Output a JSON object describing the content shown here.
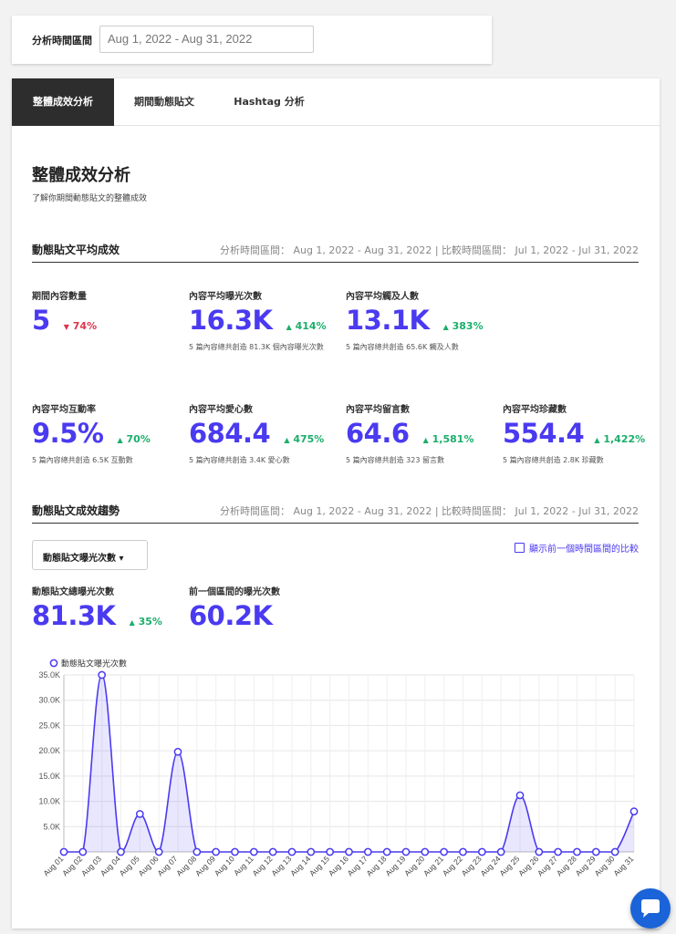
{
  "filter": {
    "label": "分析時間區間",
    "date_range": "Aug 1, 2022 - Aug 31, 2022"
  },
  "tabs": [
    {
      "label": "整體成效分析",
      "active": true
    },
    {
      "label": "期間動態貼文",
      "active": false
    },
    {
      "label": "Hashtag 分析",
      "active": false
    }
  ],
  "page": {
    "title": "整體成效分析",
    "subtitle": "了解你期間動態貼文的整體成效"
  },
  "section_avg": {
    "title": "動態貼文平均成效",
    "meta": "分析時間區間： Aug 1, 2022 - Aug 31, 2022 | 比較時間區間： Jul 1, 2022 - Jul 31, 2022"
  },
  "stats": {
    "post_count": {
      "label": "期間內容數量",
      "value": "5",
      "delta": "74%",
      "direction": "down"
    },
    "avg_impressions": {
      "label": "內容平均曝光次數",
      "value": "16.3K",
      "delta": "414%",
      "direction": "up",
      "note": "5 篇內容總共創造 81.3K 個內容曝光次數"
    },
    "avg_reach": {
      "label": "內容平均觸及人數",
      "value": "13.1K",
      "delta": "383%",
      "direction": "up",
      "note": "5 篇內容總共創造 65.6K 觸及人數"
    },
    "avg_engagement": {
      "label": "內容平均互動率",
      "value": "9.5%",
      "delta": "70%",
      "direction": "up",
      "note": "5 篇內容總共創造 6.5K 互動數"
    },
    "avg_likes": {
      "label": "內容平均愛心數",
      "value": "684.4",
      "delta": "475%",
      "direction": "up",
      "note": "5 篇內容總共創造 3.4K 愛心數"
    },
    "avg_comments": {
      "label": "內容平均留言數",
      "value": "64.6",
      "delta": "1,581%",
      "direction": "up",
      "note": "5 篇內容總共創造 323 留言數"
    },
    "avg_saves": {
      "label": "內容平均珍藏數",
      "value": "554.4",
      "delta": "1,422%",
      "direction": "up",
      "note": "5 篇內容總共創造 2.8K 珍藏數"
    }
  },
  "section_trend": {
    "title": "動態貼文成效趨勢",
    "meta": "分析時間區間： Aug 1, 2022 - Aug 31, 2022 | 比較時間區間： Jul 1, 2022 - Jul 31, 2022",
    "metric_select": "動態貼文曝光次數 ▾",
    "compare_checkbox": "顯示前一個時間區間的比較",
    "total": {
      "label": "動態貼文總曝光次數",
      "value": "81.3K",
      "delta": "35%",
      "direction": "up"
    },
    "previous": {
      "label": "前一個區間的曝光次數",
      "value": "60.2K"
    }
  },
  "colors": {
    "accent": "#4a3af0",
    "up": "#1bae6b",
    "down": "#e0334a",
    "tab_active": "#2d2d2d",
    "chat": "#1a63d8"
  },
  "icons": {
    "up": "triangle-up-icon",
    "down": "triangle-down-icon",
    "chat": "chat-bubble-icon"
  },
  "chart_data": {
    "type": "line",
    "title": "",
    "xlabel": "",
    "ylabel": "",
    "series": [
      {
        "name": "動態貼文曝光次數",
        "values": [
          0,
          0,
          35000,
          0,
          7500,
          0,
          19800,
          0,
          0,
          0,
          0,
          0,
          0,
          0,
          0,
          0,
          0,
          0,
          0,
          0,
          0,
          0,
          0,
          0,
          11200,
          0,
          0,
          0,
          0,
          0,
          8000
        ]
      }
    ],
    "categories": [
      "Aug 01",
      "Aug 02",
      "Aug 03",
      "Aug 04",
      "Aug 05",
      "Aug 06",
      "Aug 07",
      "Aug 08",
      "Aug 09",
      "Aug 10",
      "Aug 11",
      "Aug 12",
      "Aug 13",
      "Aug 14",
      "Aug 15",
      "Aug 16",
      "Aug 17",
      "Aug 18",
      "Aug 19",
      "Aug 20",
      "Aug 21",
      "Aug 22",
      "Aug 23",
      "Aug 24",
      "Aug 25",
      "Aug 26",
      "Aug 27",
      "Aug 28",
      "Aug 29",
      "Aug 30",
      "Aug 31"
    ],
    "yticks": [
      "35.0K",
      "30.0K",
      "25.0K",
      "20.0K",
      "15.0K",
      "10.0K",
      "5.0K",
      ""
    ],
    "ylim": [
      0,
      35000
    ],
    "grid": true,
    "legend": "top-left",
    "fill": true
  }
}
